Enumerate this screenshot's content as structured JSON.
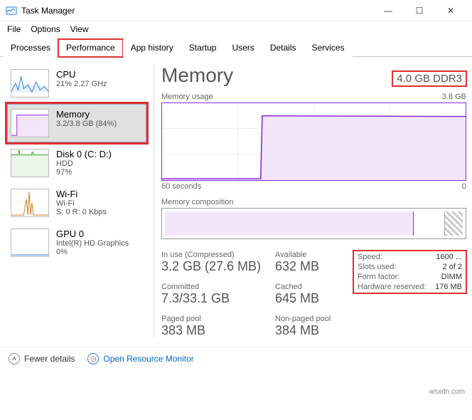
{
  "window": {
    "title": "Task Manager"
  },
  "menu": {
    "file": "File",
    "options": "Options",
    "view": "View"
  },
  "tabs": {
    "processes": "Processes",
    "performance": "Performance",
    "app_history": "App history",
    "startup": "Startup",
    "users": "Users",
    "details": "Details",
    "services": "Services"
  },
  "sidebar": {
    "cpu": {
      "name": "CPU",
      "sub": "21%  2.27 GHz"
    },
    "memory": {
      "name": "Memory",
      "sub": "3.2/3.8 GB (84%)"
    },
    "disk": {
      "name": "Disk 0 (C: D:)",
      "sub1": "HDD",
      "sub2": "97%"
    },
    "wifi": {
      "name": "Wi-Fi",
      "sub1": "Wi-Fi",
      "sub2": "S: 0 R: 0 Kbps"
    },
    "gpu": {
      "name": "GPU 0",
      "sub1": "Intel(R) HD Graphics",
      "sub2": "0%"
    }
  },
  "main": {
    "title": "Memory",
    "capacity": "4.0 GB DDR3",
    "usage_label": "Memory usage",
    "usage_max": "3.8 GB",
    "axis_left": "60 seconds",
    "axis_right": "0",
    "comp_label": "Memory composition",
    "stats": {
      "in_use_label": "In use (Compressed)",
      "in_use": "3.2 GB (27.6 MB)",
      "available_label": "Available",
      "available": "632 MB",
      "committed_label": "Committed",
      "committed": "7.3/33.1 GB",
      "cached_label": "Cached",
      "cached": "645 MB",
      "paged_label": "Paged pool",
      "paged": "383 MB",
      "nonpaged_label": "Non-paged pool",
      "nonpaged": "384 MB"
    },
    "table": {
      "speed_k": "Speed:",
      "speed_v": "1600 ...",
      "slots_k": "Slots used:",
      "slots_v": "2 of 2",
      "form_k": "Form factor:",
      "form_v": "DIMM",
      "hw_k": "Hardware reserved:",
      "hw_v": "176 MB"
    }
  },
  "footer": {
    "fewer": "Fewer details",
    "orm": "Open Resource Monitor"
  },
  "watermark": "wsxdn.com",
  "chart_data": {
    "type": "line",
    "title": "Memory usage",
    "xlabel": "60 seconds",
    "ylabel": "",
    "ylim": [
      0,
      3.8
    ],
    "x_seconds_ago": [
      60,
      55,
      50,
      45,
      42,
      41,
      40,
      35,
      30,
      25,
      20,
      15,
      10,
      5,
      0
    ],
    "values_gb": [
      0.05,
      0.05,
      0.05,
      0.05,
      0.05,
      0.05,
      3.2,
      3.2,
      3.2,
      3.2,
      3.2,
      3.2,
      3.2,
      3.2,
      3.2
    ],
    "series_name": "Memory (GB)"
  }
}
